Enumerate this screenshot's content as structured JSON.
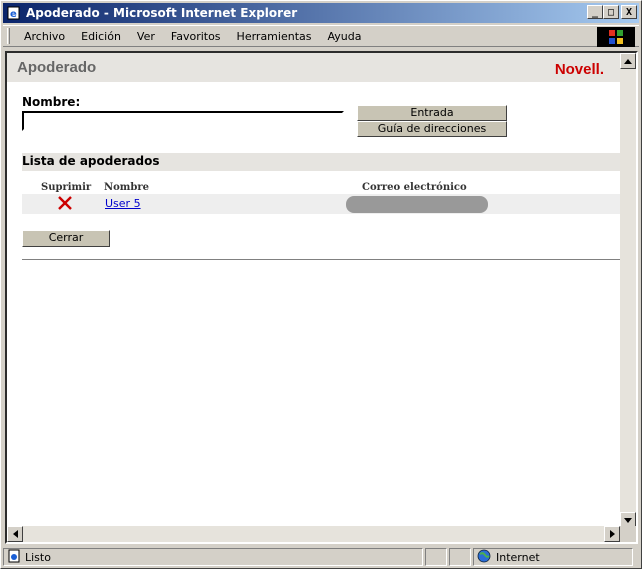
{
  "window": {
    "title": "Apoderado - Microsoft Internet Explorer",
    "minimize": "_",
    "maximize": "□",
    "close": "X"
  },
  "menu": {
    "items": [
      {
        "label": "Archivo"
      },
      {
        "label": "Edición"
      },
      {
        "label": "Ver"
      },
      {
        "label": "Favoritos"
      },
      {
        "label": "Herramientas"
      },
      {
        "label": "Ayuda"
      }
    ]
  },
  "page": {
    "title": "Apoderado",
    "brand": "Novell.",
    "nombre_label": "Nombre:",
    "nombre_value": "",
    "entrada_button": "Entrada",
    "guia_button": "Guía de direcciones",
    "section_title": "Lista de apoderados",
    "columns": {
      "suprimir": "Suprimir",
      "nombre": "Nombre",
      "correo": "Correo electrónico"
    },
    "rows": [
      {
        "nombre": "User 5"
      }
    ],
    "cerrar_button": "Cerrar"
  },
  "status": {
    "text": "Listo",
    "zone": "Internet"
  },
  "colors": {
    "brand": "#cc0000",
    "link": "#0000cc",
    "titlebar_start": "#0a246a",
    "delete_icon": "#cc0000"
  }
}
